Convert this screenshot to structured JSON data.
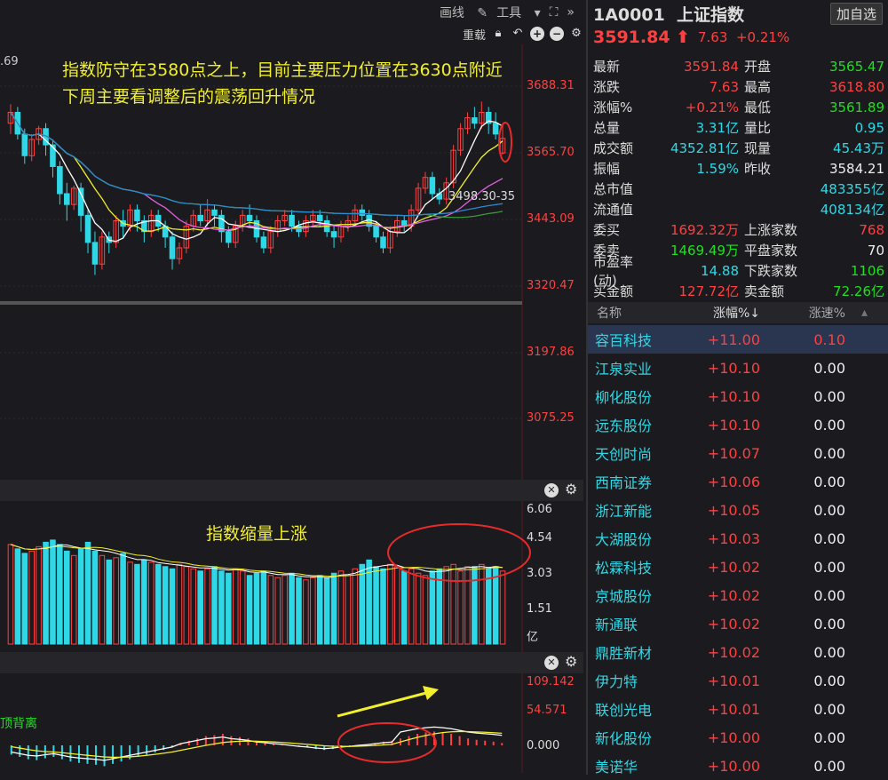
{
  "toolbar": {
    "draw": "画线",
    "tools": "工具",
    "reload": "重载"
  },
  "main_chart": {
    "corner_value": ".69",
    "ylabels": [
      "3688.31",
      "3565.70",
      "3443.09",
      "3320.47",
      "3197.86",
      "3075.25"
    ],
    "ma_label": "3498.30-35",
    "annotation_line1": "指数防守在3580点之上，目前主要压力位置在3630点附近",
    "annotation_line2": "下周主要看调整后的震荡回升情况"
  },
  "volume_chart": {
    "ylabels": [
      "6.06",
      "4.54",
      "3.03",
      "1.51"
    ],
    "unit": "亿",
    "annotation": "指数缩量上涨"
  },
  "macd_chart": {
    "ylabels": [
      "109.142",
      "54.571",
      "0.000"
    ],
    "label": "顶背离"
  },
  "colors": {
    "up": "#ff4040",
    "down": "#2fd8e6",
    "accent": "#f2ef2c",
    "circle": "#e82a2a"
  },
  "quote": {
    "code": "1A0001",
    "name": "上证指数",
    "add_button": "加自选",
    "price": "3591.84",
    "change": "7.63",
    "change_pct": "+0.21%"
  },
  "stats": [
    {
      "l1": "最新",
      "v1": "3591.84",
      "c1": "red",
      "l2": "开盘",
      "v2": "3565.47",
      "c2": "green"
    },
    {
      "l1": "涨跌",
      "v1": "7.63",
      "c1": "red",
      "l2": "最高",
      "v2": "3618.80",
      "c2": "red"
    },
    {
      "l1": "涨幅%",
      "v1": "+0.21%",
      "c1": "red",
      "l2": "最低",
      "v2": "3561.89",
      "c2": "green"
    },
    {
      "l1": "总量",
      "v1": "3.31亿",
      "c1": "cyan",
      "l2": "量比",
      "v2": "0.95",
      "c2": "cyan"
    },
    {
      "l1": "成交额",
      "v1": "4352.81亿",
      "c1": "cyan",
      "l2": "现量",
      "v2": "45.43万",
      "c2": "cyan"
    },
    {
      "l1": "振幅",
      "v1": "1.59%",
      "c1": "cyan",
      "l2": "昨收",
      "v2": "3584.21",
      "c2": "white"
    },
    {
      "l1": "总市值",
      "v1": "",
      "c1": "cyan",
      "l2": "",
      "v2": "483355亿",
      "c2": "cyan"
    },
    {
      "l1": "流通值",
      "v1": "",
      "c1": "cyan",
      "l2": "",
      "v2": "408134亿",
      "c2": "cyan"
    },
    {
      "l1": "委买",
      "v1": "1692.32万",
      "c1": "red",
      "l2": "上涨家数",
      "v2": "768",
      "c2": "red"
    },
    {
      "l1": "委卖",
      "v1": "1469.49万",
      "c1": "green",
      "l2": "平盘家数",
      "v2": "70",
      "c2": "white"
    },
    {
      "l1": "市盈率(动)",
      "v1": "14.88",
      "c1": "cyan",
      "l2": "下跌家数",
      "v2": "1106",
      "c2": "green"
    },
    {
      "l1": "买金额",
      "v1": "127.72亿",
      "c1": "red",
      "l2": "卖金额",
      "v2": "72.26亿",
      "c2": "green"
    }
  ],
  "list": {
    "headers": [
      "名称",
      "涨幅%↓",
      "涨速%"
    ],
    "rows": [
      {
        "name": "容百科技",
        "pct": "+11.00",
        "speed": "0.10"
      },
      {
        "name": "江泉实业",
        "pct": "+10.10",
        "speed": "0.00"
      },
      {
        "name": "柳化股份",
        "pct": "+10.10",
        "speed": "0.00"
      },
      {
        "name": "远东股份",
        "pct": "+10.10",
        "speed": "0.00"
      },
      {
        "name": "天创时尚",
        "pct": "+10.07",
        "speed": "0.00"
      },
      {
        "name": "西南证券",
        "pct": "+10.06",
        "speed": "0.00"
      },
      {
        "name": "浙江新能",
        "pct": "+10.05",
        "speed": "0.00"
      },
      {
        "name": "大湖股份",
        "pct": "+10.03",
        "speed": "0.00"
      },
      {
        "name": "松霖科技",
        "pct": "+10.02",
        "speed": "0.00"
      },
      {
        "name": "京城股份",
        "pct": "+10.02",
        "speed": "0.00"
      },
      {
        "name": "新通联",
        "pct": "+10.02",
        "speed": "0.00"
      },
      {
        "name": "鼎胜新材",
        "pct": "+10.02",
        "speed": "0.00"
      },
      {
        "name": "伊力特",
        "pct": "+10.01",
        "speed": "0.00"
      },
      {
        "name": "联创光电",
        "pct": "+10.01",
        "speed": "0.00"
      },
      {
        "name": "新化股份",
        "pct": "+10.00",
        "speed": "0.00"
      },
      {
        "name": "美诺华",
        "pct": "+10.00",
        "speed": "0.00"
      }
    ]
  },
  "chart_data": {
    "type": "candlestick",
    "candles": [
      [
        3620,
        3640,
        3600,
        3655
      ],
      [
        3640,
        3600,
        3590,
        3650
      ],
      [
        3600,
        3560,
        3545,
        3610
      ],
      [
        3560,
        3590,
        3550,
        3600
      ],
      [
        3590,
        3610,
        3580,
        3615
      ],
      [
        3610,
        3580,
        3560,
        3620
      ],
      [
        3580,
        3540,
        3520,
        3590
      ],
      [
        3540,
        3490,
        3470,
        3550
      ],
      [
        3490,
        3470,
        3440,
        3510
      ],
      [
        3470,
        3500,
        3460,
        3505
      ],
      [
        3500,
        3450,
        3420,
        3510
      ],
      [
        3450,
        3400,
        3380,
        3460
      ],
      [
        3400,
        3360,
        3340,
        3420
      ],
      [
        3360,
        3410,
        3350,
        3420
      ],
      [
        3410,
        3400,
        3380,
        3420
      ],
      [
        3400,
        3440,
        3390,
        3450
      ],
      [
        3440,
        3430,
        3410,
        3460
      ],
      [
        3430,
        3460,
        3420,
        3470
      ],
      [
        3460,
        3440,
        3420,
        3470
      ],
      [
        3440,
        3420,
        3400,
        3450
      ],
      [
        3420,
        3450,
        3410,
        3460
      ],
      [
        3450,
        3430,
        3420,
        3460
      ],
      [
        3430,
        3410,
        3390,
        3440
      ],
      [
        3410,
        3370,
        3350,
        3420
      ],
      [
        3370,
        3390,
        3360,
        3400
      ],
      [
        3390,
        3430,
        3380,
        3440
      ],
      [
        3430,
        3450,
        3420,
        3460
      ],
      [
        3450,
        3440,
        3430,
        3470
      ],
      [
        3440,
        3460,
        3430,
        3480
      ],
      [
        3460,
        3450,
        3430,
        3470
      ],
      [
        3450,
        3420,
        3400,
        3460
      ],
      [
        3420,
        3400,
        3390,
        3430
      ],
      [
        3400,
        3430,
        3390,
        3440
      ],
      [
        3430,
        3450,
        3420,
        3460
      ],
      [
        3450,
        3440,
        3430,
        3470
      ],
      [
        3440,
        3410,
        3400,
        3450
      ],
      [
        3410,
        3390,
        3380,
        3420
      ],
      [
        3390,
        3420,
        3380,
        3430
      ],
      [
        3420,
        3440,
        3410,
        3450
      ],
      [
        3440,
        3450,
        3430,
        3460
      ],
      [
        3450,
        3430,
        3420,
        3460
      ],
      [
        3430,
        3420,
        3410,
        3440
      ],
      [
        3420,
        3440,
        3410,
        3450
      ],
      [
        3440,
        3450,
        3430,
        3460
      ],
      [
        3450,
        3440,
        3430,
        3460
      ],
      [
        3440,
        3420,
        3410,
        3450
      ],
      [
        3420,
        3410,
        3390,
        3430
      ],
      [
        3410,
        3430,
        3400,
        3440
      ],
      [
        3430,
        3440,
        3420,
        3450
      ],
      [
        3440,
        3460,
        3430,
        3470
      ],
      [
        3460,
        3450,
        3440,
        3470
      ],
      [
        3450,
        3430,
        3420,
        3460
      ],
      [
        3430,
        3410,
        3400,
        3440
      ],
      [
        3410,
        3390,
        3380,
        3420
      ],
      [
        3390,
        3420,
        3380,
        3430
      ],
      [
        3420,
        3440,
        3410,
        3450
      ],
      [
        3440,
        3430,
        3420,
        3450
      ],
      [
        3430,
        3460,
        3420,
        3470
      ],
      [
        3460,
        3500,
        3450,
        3510
      ],
      [
        3500,
        3520,
        3490,
        3530
      ],
      [
        3520,
        3490,
        3480,
        3530
      ],
      [
        3490,
        3480,
        3470,
        3500
      ],
      [
        3480,
        3510,
        3470,
        3520
      ],
      [
        3510,
        3570,
        3500,
        3580
      ],
      [
        3570,
        3610,
        3560,
        3620
      ],
      [
        3610,
        3630,
        3600,
        3640
      ],
      [
        3630,
        3620,
        3610,
        3650
      ],
      [
        3620,
        3640,
        3610,
        3660
      ],
      [
        3640,
        3620,
        3600,
        3650
      ],
      [
        3620,
        3600,
        3590,
        3640
      ],
      [
        3565,
        3592,
        3562,
        3619
      ]
    ],
    "volume": [
      4.5,
      4.3,
      4.1,
      4.2,
      4.4,
      4.6,
      4.7,
      4.5,
      4.2,
      4.0,
      4.3,
      4.6,
      4.2,
      4.0,
      3.8,
      3.9,
      4.1,
      3.7,
      3.6,
      3.8,
      3.7,
      3.6,
      3.5,
      3.4,
      3.6,
      3.5,
      3.4,
      3.3,
      3.4,
      3.5,
      3.3,
      3.2,
      3.4,
      3.3,
      3.1,
      3.2,
      3.3,
      3.1,
      3.0,
      3.1,
      3.2,
      3.0,
      2.9,
      3.0,
      3.1,
      3.0,
      3.2,
      3.3,
      3.1,
      3.4,
      3.6,
      3.8,
      3.5,
      3.4,
      3.6,
      3.5,
      3.3,
      3.4,
      3.2,
      3.1,
      3.3,
      3.4,
      3.5,
      3.6,
      3.3,
      3.5,
      3.5,
      3.6,
      3.4,
      3.5,
      3.3
    ],
    "macd_hist": [
      -20,
      -25,
      -30,
      -32,
      -28,
      -25,
      -30,
      -35,
      -38,
      -40,
      -42,
      -45,
      -40,
      -35,
      -30,
      -25,
      -20,
      -15,
      -10,
      -5,
      5,
      10,
      15,
      20,
      22,
      25,
      20,
      18,
      15,
      10,
      8,
      5,
      3,
      0,
      -3,
      -5,
      -8,
      -10,
      -8,
      -5,
      -3,
      0,
      2,
      5,
      8,
      10,
      15,
      20,
      25,
      28,
      30,
      28,
      25,
      20,
      15,
      12,
      10,
      8,
      5
    ]
  }
}
